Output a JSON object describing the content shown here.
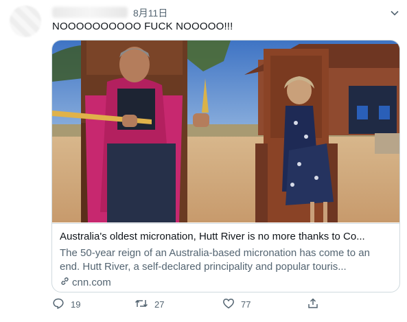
{
  "tweet": {
    "timestamp": "8月11日",
    "text": "NOOOOOOOOOO FUCK NOOOOO!!!"
  },
  "card": {
    "title": "Australia's oldest micronation, Hutt River is no more thanks to Co...",
    "description": "The 50-year reign of an Australia-based micronation has come to an end. Hutt River, a self-declared principality and popular touris...",
    "domain": "cnn.com"
  },
  "actions": {
    "replies": "19",
    "retweets": "27",
    "likes": "77"
  },
  "icons": {
    "menu": "chevron-down-icon",
    "link": "link-icon",
    "reply": "reply-icon",
    "retweet": "retweet-icon",
    "like": "heart-icon",
    "share": "share-icon"
  },
  "colors": {
    "text": "#0f1419",
    "secondary": "#536471",
    "border": "#cfd9de"
  }
}
